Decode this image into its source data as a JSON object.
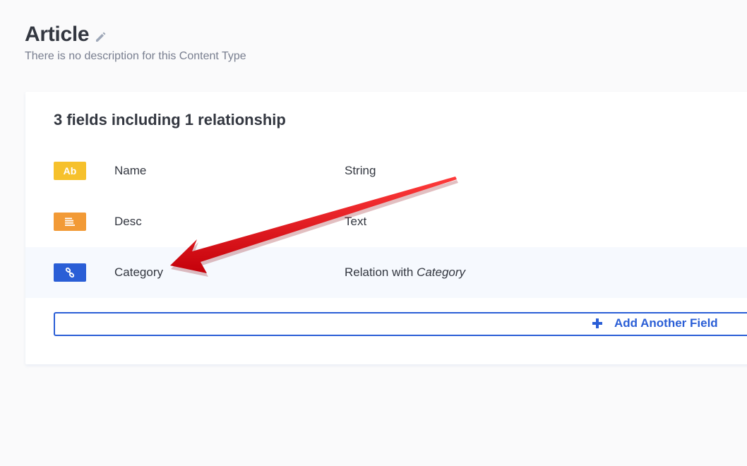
{
  "header": {
    "title": "Article",
    "description": "There is no description for this Content Type"
  },
  "card": {
    "summary": "3 fields including 1 relationship",
    "fields": [
      {
        "icon_label": "Ab",
        "icon": "text-icon",
        "icon_color": "#f6c12c",
        "name": "Name",
        "type": "String"
      },
      {
        "icon_label": "",
        "icon": "paragraph-icon",
        "icon_color": "#f29a36",
        "name": "Desc",
        "type": "Text"
      },
      {
        "icon_label": "",
        "icon": "link-icon",
        "icon_color": "#2a5ed6",
        "name": "Category",
        "type_prefix": "Relation with ",
        "type_target": "Category"
      }
    ],
    "add_button_label": "Add Another Field"
  },
  "colors": {
    "primary": "#2a5ed6",
    "annotation_arrow": "#e8121b"
  }
}
